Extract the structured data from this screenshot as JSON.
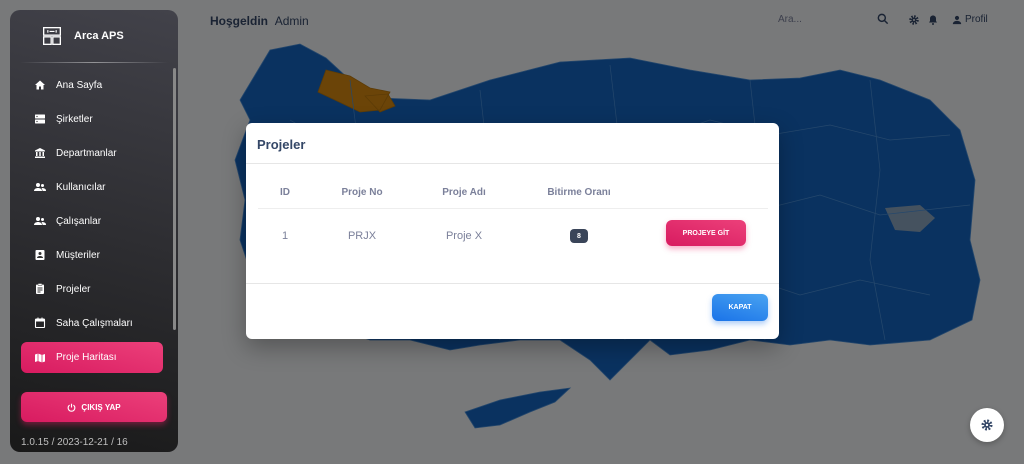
{
  "header": {
    "greeting": "Hoşgeldin",
    "user": "Admin",
    "search_placeholder": "Ara...",
    "profile_label": "Profil"
  },
  "sidebar": {
    "brand": "Arca APS",
    "items": [
      {
        "label": "Ana Sayfa",
        "icon": "home-icon"
      },
      {
        "label": "Şirketler",
        "icon": "storage-icon"
      },
      {
        "label": "Departmanlar",
        "icon": "bank-icon"
      },
      {
        "label": "Kullanıcılar",
        "icon": "users-icon"
      },
      {
        "label": "Çalışanlar",
        "icon": "users-icon"
      },
      {
        "label": "Müşteriler",
        "icon": "contact-icon"
      },
      {
        "label": "Projeler",
        "icon": "clipboard-icon"
      },
      {
        "label": "Saha Çalışmaları",
        "icon": "calendar-icon"
      },
      {
        "label": "Proje Haritası",
        "icon": "map-icon",
        "active": true
      }
    ],
    "logout_label": "ÇIKIŞ YAP",
    "version": "1.0.15 / 2023-12-21 / 16"
  },
  "modal": {
    "title": "Projeler",
    "columns": [
      "ID",
      "Proje No",
      "Proje Adı",
      "Bitirme Oranı"
    ],
    "rows": [
      {
        "id": "1",
        "proje_no": "PRJX",
        "proje_adi": "Proje X",
        "bitirme_orani": "8",
        "action": "PROJEYE GİT"
      }
    ],
    "close_label": "KAPAT"
  },
  "colors": {
    "map_fill": "#1565c0",
    "map_highlight": "#d68910",
    "primary": "#e91e63",
    "info": "#1a73e8",
    "sidebar_dark": "#191919"
  }
}
